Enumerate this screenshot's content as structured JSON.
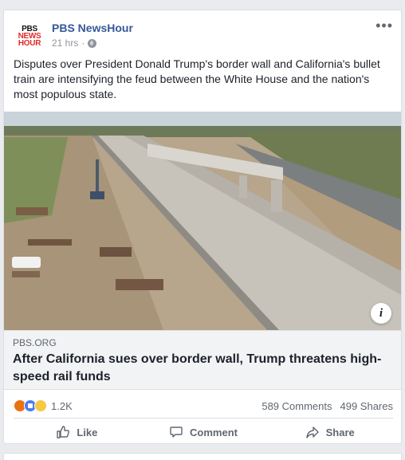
{
  "post": {
    "logo": {
      "line1": "PBS",
      "line2": "NEWS",
      "line3": "HOUR"
    },
    "page_name": "PBS NewsHour",
    "time": "21 hrs",
    "more_label": "•••",
    "caption": "Disputes over President Donald Trump's border wall and California's bullet train are intensifying the feud between the White House and the nation's most populous state."
  },
  "link": {
    "domain": "PBS.ORG",
    "headline": "After California sues over border wall, Trump threatens high-speed rail funds",
    "info_label": "i"
  },
  "stats": {
    "reaction_count": "1.2K",
    "comments": "589 Comments",
    "shares": "499 Shares"
  },
  "actions": {
    "like": "Like",
    "comment": "Comment",
    "share": "Share"
  },
  "colors": {
    "link_blue": "#365899",
    "meta_gray": "#90949c",
    "action_gray": "#606770"
  }
}
